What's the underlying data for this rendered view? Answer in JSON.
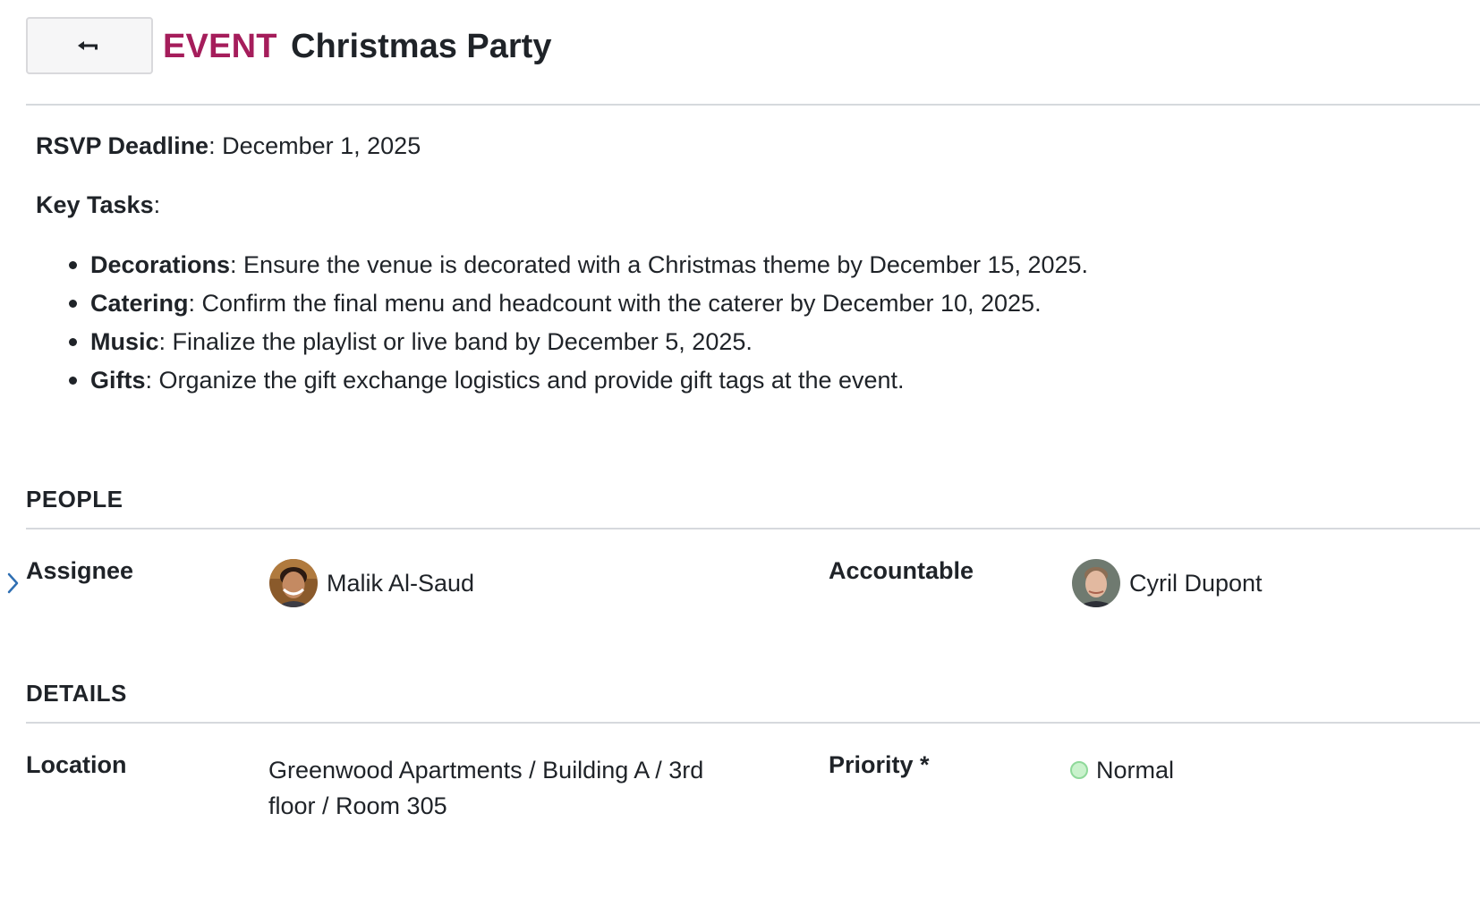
{
  "header": {
    "type_label": "EVENT",
    "title": "Christmas Party",
    "back_icon": "arrow-left-icon"
  },
  "description": {
    "rsvp_label": "RSVP Deadline",
    "rsvp_value": ": December 1, 2025",
    "key_tasks_label": "Key Tasks",
    "key_tasks_colon": ":",
    "tasks": [
      {
        "name": "Decorations",
        "text": ": Ensure the venue is decorated with a Christmas theme by December 15, 2025."
      },
      {
        "name": "Catering",
        "text": ": Confirm the final menu and headcount with the caterer by December 10, 2025."
      },
      {
        "name": "Music",
        "text": ": Finalize the playlist or live band by December 5, 2025."
      },
      {
        "name": "Gifts",
        "text": ": Organize the gift exchange logistics and provide gift tags at the event."
      }
    ]
  },
  "people": {
    "section_title": "PEOPLE",
    "assignee_label": "Assignee",
    "assignee_name": "Malik Al-Saud",
    "accountable_label": "Accountable",
    "accountable_name": "Cyril Dupont",
    "expand_icon": "chevron-right-icon"
  },
  "details": {
    "section_title": "DETAILS",
    "location_label": "Location",
    "location_line1": "Greenwood Apartments / Building A / 3rd",
    "location_line2": "floor / Room 305",
    "priority_label": "Priority *",
    "priority_value": "Normal",
    "priority_color": "#c9f2cc"
  },
  "colors": {
    "accent": "#a51d5b",
    "text": "#1f2328",
    "rule": "#d6d9dd"
  }
}
